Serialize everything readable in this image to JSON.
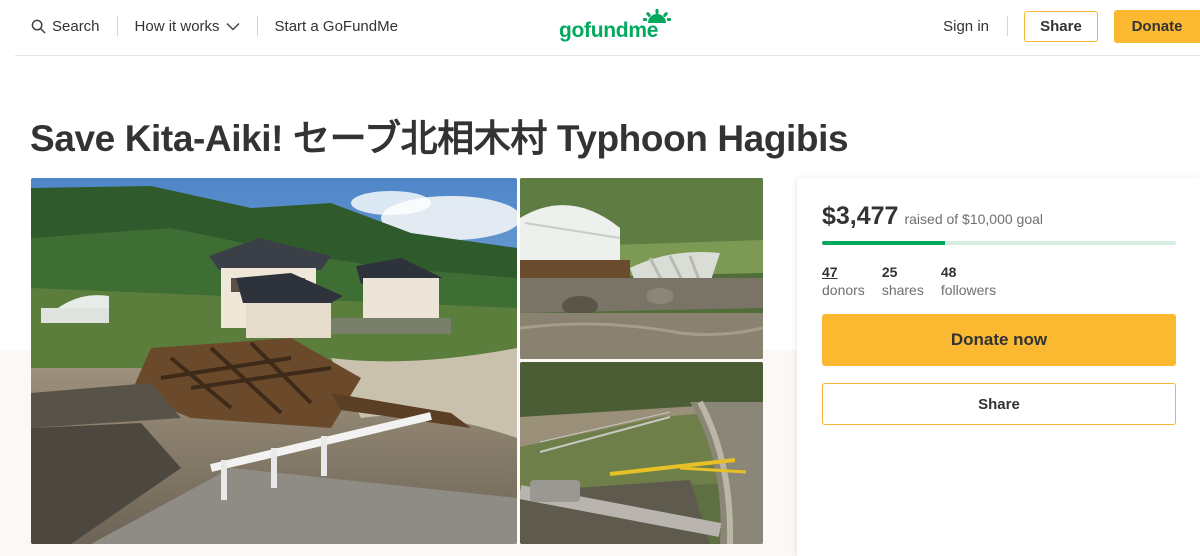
{
  "header": {
    "search_label": "Search",
    "how_it_works_label": "How it works",
    "start_label": "Start a GoFundMe",
    "logo_text": "gofundme",
    "sign_in_label": "Sign in",
    "share_label": "Share",
    "donate_label": "Donate"
  },
  "campaign": {
    "title": "Save Kita-Aiki! セーブ北相木村 Typhoon Hagibis"
  },
  "donation": {
    "raised_amount": "$3,477",
    "goal_text": "raised of $10,000 goal",
    "progress_fraction": 0.3477,
    "stats": [
      {
        "value": "47",
        "label": "donors"
      },
      {
        "value": "25",
        "label": "shares"
      },
      {
        "value": "48",
        "label": "followers"
      }
    ],
    "donate_now_label": "Donate now",
    "share_label": "Share"
  },
  "colors": {
    "brand_green": "#02a95c",
    "accent_yellow": "#fbb831"
  },
  "icons": {
    "search": "search-icon",
    "chevron": "chevron-down-icon"
  }
}
